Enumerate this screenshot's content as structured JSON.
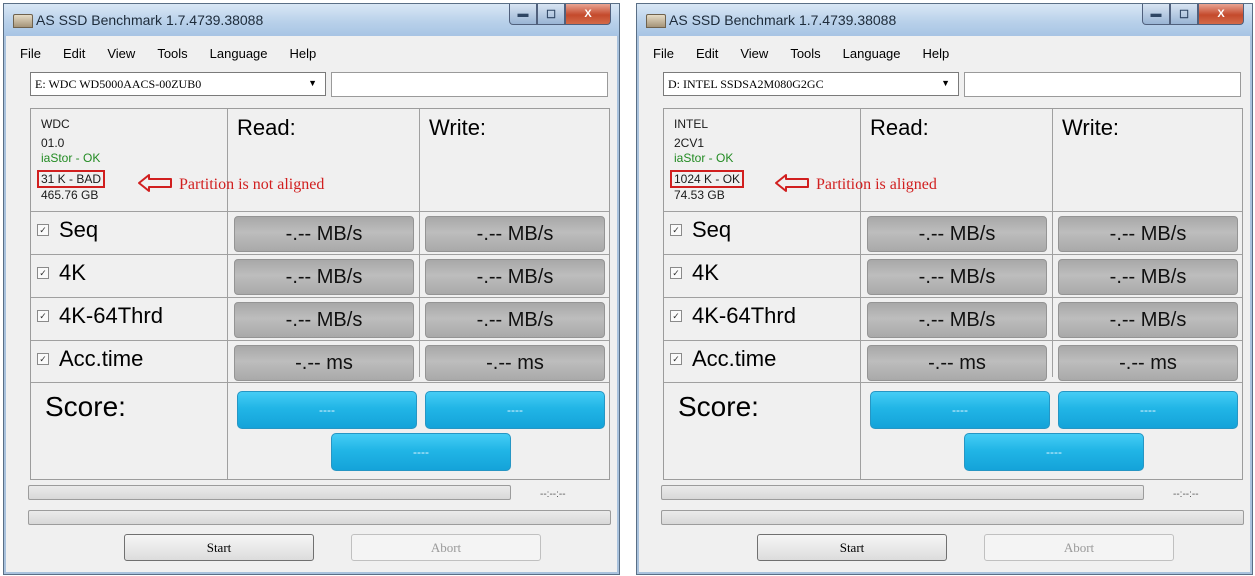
{
  "windows": [
    {
      "title": "AS SSD Benchmark 1.7.4739.38088",
      "menu": [
        "File",
        "Edit",
        "View",
        "Tools",
        "Language",
        "Help"
      ],
      "drive": "E: WDC WD5000AACS-00ZUB0",
      "info": [
        "WDC",
        "01.0",
        "iaStor - OK",
        "31 K - BAD",
        "465.76 GB"
      ],
      "annotation": "Partition is not aligned",
      "headers": {
        "read": "Read:",
        "write": "Write:"
      },
      "rows": [
        {
          "label": "Seq",
          "read": "-.-- MB/s",
          "write": "-.-- MB/s"
        },
        {
          "label": "4K",
          "read": "-.-- MB/s",
          "write": "-.-- MB/s"
        },
        {
          "label": "4K-64Thrd",
          "read": "-.-- MB/s",
          "write": "-.-- MB/s"
        },
        {
          "label": "Acc.time",
          "read": "-.-- ms",
          "write": "-.-- ms"
        }
      ],
      "score_label": "Score:",
      "scores": {
        "read": "----",
        "write": "----",
        "total": "----"
      },
      "time": "--:--:--",
      "buttons": {
        "start": "Start",
        "abort": "Abort"
      },
      "checkbox_mark": "✓",
      "controls": {
        "min": "▬",
        "max": "☐",
        "close": "X"
      }
    },
    {
      "title": "AS SSD Benchmark 1.7.4739.38088",
      "menu": [
        "File",
        "Edit",
        "View",
        "Tools",
        "Language",
        "Help"
      ],
      "drive": "D: INTEL SSDSA2M080G2GC",
      "info": [
        "INTEL",
        "2CV1",
        "iaStor - OK",
        "1024 K - OK",
        "74.53 GB"
      ],
      "annotation": "Partition is aligned",
      "headers": {
        "read": "Read:",
        "write": "Write:"
      },
      "rows": [
        {
          "label": "Seq",
          "read": "-.-- MB/s",
          "write": "-.-- MB/s"
        },
        {
          "label": "4K",
          "read": "-.-- MB/s",
          "write": "-.-- MB/s"
        },
        {
          "label": "4K-64Thrd",
          "read": "-.-- MB/s",
          "write": "-.-- MB/s"
        },
        {
          "label": "Acc.time",
          "read": "-.-- ms",
          "write": "-.-- ms"
        }
      ],
      "score_label": "Score:",
      "scores": {
        "read": "----",
        "write": "----",
        "total": "----"
      },
      "time": "--:--:--",
      "buttons": {
        "start": "Start",
        "abort": "Abort"
      },
      "checkbox_mark": "✓",
      "controls": {
        "min": "▬",
        "max": "☐",
        "close": "X"
      }
    }
  ],
  "colors": {
    "annotation_red": "#d11f1f",
    "score_blue": "#21b5e6",
    "ok_green": "#228b22"
  }
}
